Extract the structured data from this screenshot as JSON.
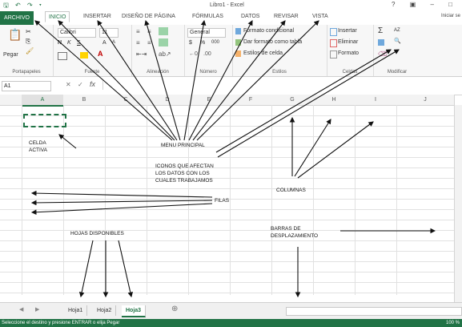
{
  "window": {
    "title": "Libro1 - Excel",
    "controls": "? ▣ –  □"
  },
  "ribbon_tabs": [
    "ARCHIVO",
    "INICIO",
    "INSERTAR",
    "DISEÑO DE PÁGINA",
    "FÓRMULAS",
    "DATOS",
    "REVISAR",
    "VISTA"
  ],
  "signin": "Iniciar se",
  "clipboard": {
    "label": "Portapapeles",
    "paste": "Pegar"
  },
  "font": {
    "name": "Calibri",
    "size": "11",
    "bold": "N",
    "italic": "K",
    "underline": "S",
    "grow": "A",
    "shrink": "A",
    "label": "Fuente"
  },
  "alignment": {
    "label": "Alineación"
  },
  "number": {
    "format": "General",
    "currency": "$",
    "percent": "%",
    "thousands": "000",
    "label": "Número"
  },
  "styles": {
    "conditional": "Formato condicional",
    "table": "Dar formato como tabla",
    "cell_styles": "Estilos de celda",
    "label": "Estilos"
  },
  "cells": {
    "insert": "Insertar",
    "delete": "Eliminar",
    "format": "Formato",
    "label": "Celdas"
  },
  "editing": {
    "label": "Modificar",
    "sum": "Σ",
    "sort": "AZ",
    "find": "🔍"
  },
  "formula_bar": {
    "namebox": "A1",
    "cancel": "✕",
    "enter": "✓",
    "fx": "fx"
  },
  "columns": [
    "A",
    "B",
    "C",
    "D",
    "E",
    "F",
    "G",
    "H",
    "I",
    "J"
  ],
  "annotations": {
    "celda_activa_1": "CELDA",
    "celda_activa_2": "ACTIVA",
    "menu": "MENU PRINCIPAL",
    "iconos_1": "ICONOS QUE AFECTAN",
    "iconos_2": "LOS DATOS CON LOS",
    "iconos_3": "CUALES TRABAJAMOS",
    "columnas": "COLUMNAS",
    "filas": "FILAS",
    "hojas": "HOJAS DISPONIBLES",
    "barras_1": "BARRAS DE",
    "barras_2": "DESPLAZAMIENTO"
  },
  "sheets": [
    "Hoja1",
    "Hoja2",
    "Hoja3"
  ],
  "add_sheet": "⊕",
  "status": {
    "message": "Seleccione el destino y presione ENTRAR o elija Pegar",
    "zoom": "100 %"
  }
}
